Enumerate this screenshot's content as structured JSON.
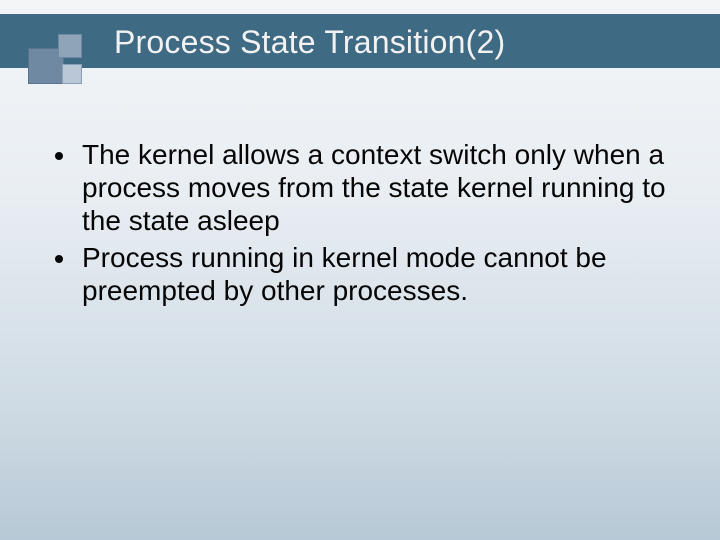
{
  "slide": {
    "title": "Process State Transition(2)",
    "bullets": [
      "The kernel allows a context switch only when a process moves from the state kernel running to the state asleep",
      "Process running in kernel mode cannot be preempted by other processes."
    ]
  },
  "theme": {
    "title_bg": "#3f6a84",
    "title_fg": "#f2f2f2"
  }
}
